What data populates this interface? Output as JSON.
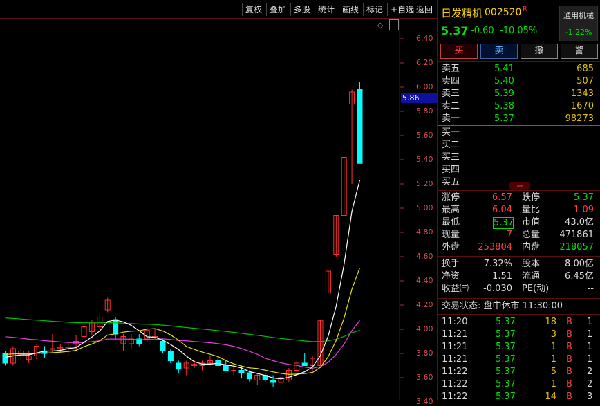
{
  "toolbar": {
    "items": [
      "复权",
      "叠加",
      "多股",
      "统计",
      "画线",
      "标记",
      "+自选",
      "返回"
    ]
  },
  "chart_data": {
    "type": "candlestick",
    "yaxis": {
      "ticks": [
        "6.40",
        "6.20",
        "6.00",
        "5.80",
        "5.60",
        "5.40",
        "5.20",
        "5.00",
        "4.80",
        "4.60",
        "4.40",
        "4.20",
        "4.00",
        "3.80",
        "3.60",
        "3.40"
      ]
    },
    "current_price_flag": "5.86",
    "candles": [
      {
        "o": 3.8,
        "h": 3.82,
        "l": 3.7,
        "c": 3.72
      },
      {
        "o": 3.72,
        "h": 3.86,
        "l": 3.7,
        "c": 3.84
      },
      {
        "o": 3.78,
        "h": 3.84,
        "l": 3.74,
        "c": 3.82
      },
      {
        "o": 3.75,
        "h": 3.82,
        "l": 3.72,
        "c": 3.78
      },
      {
        "o": 3.78,
        "h": 3.88,
        "l": 3.75,
        "c": 3.86
      },
      {
        "o": 3.82,
        "h": 3.86,
        "l": 3.76,
        "c": 3.8
      },
      {
        "o": 3.84,
        "h": 3.96,
        "l": 3.8,
        "c": 3.84
      },
      {
        "o": 3.84,
        "h": 3.88,
        "l": 3.8,
        "c": 3.85
      },
      {
        "o": 3.84,
        "h": 3.9,
        "l": 3.78,
        "c": 3.85
      },
      {
        "o": 3.88,
        "h": 3.95,
        "l": 3.82,
        "c": 3.9
      },
      {
        "o": 3.94,
        "h": 4.04,
        "l": 3.9,
        "c": 4.02
      },
      {
        "o": 3.98,
        "h": 4.08,
        "l": 3.95,
        "c": 4.06
      },
      {
        "o": 4.02,
        "h": 4.12,
        "l": 4.0,
        "c": 4.1
      },
      {
        "o": 4.16,
        "h": 4.26,
        "l": 4.14,
        "c": 4.24
      },
      {
        "o": 4.08,
        "h": 4.1,
        "l": 3.92,
        "c": 3.96
      },
      {
        "o": 3.88,
        "h": 3.96,
        "l": 3.82,
        "c": 3.94
      },
      {
        "o": 3.88,
        "h": 3.96,
        "l": 3.84,
        "c": 3.92
      },
      {
        "o": 3.92,
        "h": 3.96,
        "l": 3.86,
        "c": 3.88
      },
      {
        "o": 3.92,
        "h": 4.02,
        "l": 3.9,
        "c": 3.99
      },
      {
        "o": 3.94,
        "h": 4.0,
        "l": 3.92,
        "c": 3.94
      },
      {
        "o": 3.9,
        "h": 3.92,
        "l": 3.8,
        "c": 3.82
      },
      {
        "o": 3.82,
        "h": 3.84,
        "l": 3.72,
        "c": 3.74
      },
      {
        "o": 3.72,
        "h": 3.74,
        "l": 3.64,
        "c": 3.67
      },
      {
        "o": 3.68,
        "h": 3.74,
        "l": 3.62,
        "c": 3.72
      },
      {
        "o": 3.7,
        "h": 3.74,
        "l": 3.68,
        "c": 3.71
      },
      {
        "o": 3.7,
        "h": 3.74,
        "l": 3.66,
        "c": 3.72
      },
      {
        "o": 3.72,
        "h": 3.78,
        "l": 3.7,
        "c": 3.74
      },
      {
        "o": 3.74,
        "h": 3.78,
        "l": 3.7,
        "c": 3.7
      },
      {
        "o": 3.7,
        "h": 3.74,
        "l": 3.66,
        "c": 3.66
      },
      {
        "o": 3.66,
        "h": 3.7,
        "l": 3.62,
        "c": 3.66
      },
      {
        "o": 3.66,
        "h": 3.7,
        "l": 3.6,
        "c": 3.64
      },
      {
        "o": 3.64,
        "h": 3.66,
        "l": 3.56,
        "c": 3.59
      },
      {
        "o": 3.58,
        "h": 3.64,
        "l": 3.54,
        "c": 3.62
      },
      {
        "o": 3.62,
        "h": 3.64,
        "l": 3.56,
        "c": 3.58
      },
      {
        "o": 3.58,
        "h": 3.62,
        "l": 3.52,
        "c": 3.56
      },
      {
        "o": 3.56,
        "h": 3.62,
        "l": 3.52,
        "c": 3.6
      },
      {
        "o": 3.58,
        "h": 3.68,
        "l": 3.56,
        "c": 3.66
      },
      {
        "o": 3.66,
        "h": 3.74,
        "l": 3.64,
        "c": 3.72
      },
      {
        "o": 3.72,
        "h": 3.8,
        "l": 3.7,
        "c": 3.7
      },
      {
        "o": 3.7,
        "h": 3.78,
        "l": 3.66,
        "c": 3.76
      },
      {
        "o": 3.7,
        "h": 4.08,
        "l": 3.7,
        "c": 4.07
      },
      {
        "o": 4.3,
        "h": 4.48,
        "l": 4.3,
        "c": 4.48
      },
      {
        "o": 4.62,
        "h": 4.94,
        "l": 4.6,
        "c": 4.94
      },
      {
        "o": 4.94,
        "h": 5.42,
        "l": 4.94,
        "c": 5.42
      },
      {
        "o": 5.86,
        "h": 5.98,
        "l": 5.2,
        "c": 5.96
      },
      {
        "o": 5.98,
        "h": 6.04,
        "l": 5.37,
        "c": 5.37
      }
    ],
    "ma_colors": {
      "ma5": "#ffffff",
      "ma10": "#e6e600",
      "ma20": "#e040e0",
      "ma60": "#00c000"
    }
  },
  "colors": {
    "up": "#ff3030",
    "down": "#00ffff",
    "grid": "#5a1010",
    "accent": "#1010a0"
  },
  "stock": {
    "name": "日发精机",
    "code": "002520",
    "mark": "R",
    "sector": "通用机械",
    "sector_change": "-1.22%",
    "price": "5.37",
    "change": "-0.60",
    "change_pct": "-10.05%"
  },
  "trade_buttons": [
    "买",
    "卖",
    "撤",
    "警"
  ],
  "asks": [
    {
      "label": "卖五",
      "price": "5.41",
      "vol": "685"
    },
    {
      "label": "卖四",
      "price": "5.40",
      "vol": "507"
    },
    {
      "label": "卖三",
      "price": "5.39",
      "vol": "1343"
    },
    {
      "label": "卖二",
      "price": "5.38",
      "vol": "1670"
    },
    {
      "label": "卖一",
      "price": "5.37",
      "vol": "98273"
    }
  ],
  "bids": [
    "买一",
    "买二",
    "买三",
    "买四",
    "买五"
  ],
  "stats": {
    "zhangting_label": "涨停",
    "zhangting": "6.57",
    "dieting_label": "跌停",
    "dieting": "5.37",
    "high_label": "最高",
    "high": "6.04",
    "liangbi_label": "量比",
    "liangbi": "1.09",
    "low_label": "最低",
    "low": "5.37",
    "shizhi_label": "市值",
    "shizhi": "43.0亿",
    "xianliang_label": "现量",
    "xianliang": "7",
    "zongliang_label": "总量",
    "zongliang": "471861",
    "waipan_label": "外盘",
    "waipan": "253804",
    "neipan_label": "内盘",
    "neipan": "218057",
    "huanshou_label": "换手",
    "huanshou": "7.32%",
    "guben_label": "股本",
    "guben": "8.00亿",
    "jingzi_label": "净资",
    "jingzi": "1.51",
    "liutong_label": "流通",
    "liutong": "6.45亿",
    "shouyi_label": "收益㈢",
    "shouyi": "-0.030",
    "pe_label": "PE(动)",
    "pe": "--"
  },
  "trade_status": "交易状态: 盘中休市 11:30:00",
  "ticks": [
    {
      "t": "11:20",
      "p": "5.37",
      "v": "18",
      "s": "B",
      "n": "1"
    },
    {
      "t": "11:21",
      "p": "5.37",
      "v": "3",
      "s": "B",
      "n": "1"
    },
    {
      "t": "11:21",
      "p": "5.37",
      "v": "1",
      "s": "B",
      "n": "1"
    },
    {
      "t": "11:21",
      "p": "5.37",
      "v": "1",
      "s": "B",
      "n": "1"
    },
    {
      "t": "11:22",
      "p": "5.37",
      "v": "5",
      "s": "B",
      "n": "2"
    },
    {
      "t": "11:22",
      "p": "5.37",
      "v": "1",
      "s": "B",
      "n": "2"
    },
    {
      "t": "11:22",
      "p": "5.37",
      "v": "14",
      "s": "B",
      "n": "3"
    }
  ]
}
